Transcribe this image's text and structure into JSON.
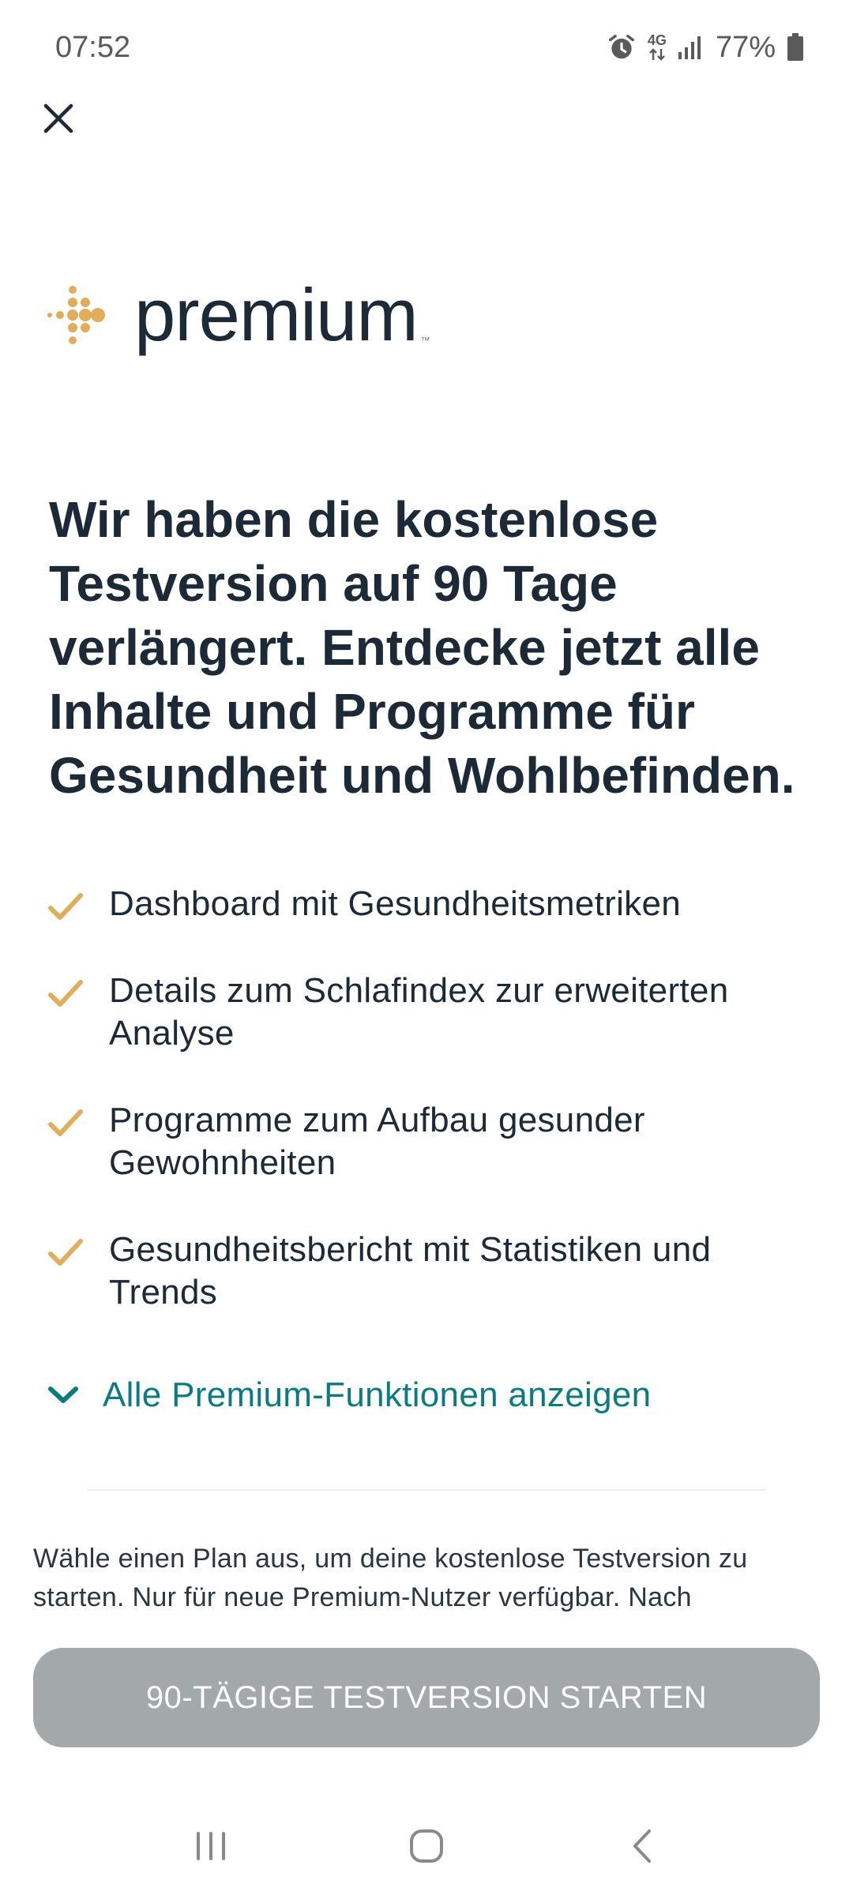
{
  "status_bar": {
    "time": "07:52",
    "network": "4G",
    "battery": "77%",
    "icons": [
      "alarm-icon",
      "network-4g-icon",
      "signal-icon",
      "battery-icon"
    ]
  },
  "close_icon": "close-icon",
  "logo": {
    "word": "premium",
    "tm": "™",
    "accent_color": "#e0ad5a"
  },
  "headline": "Wir haben die kostenlose Testversion auf 90 Tage verlängert. Entdecke jetzt alle Inhalte und Programme für Gesundheit und Wohlbefinden.",
  "features": [
    "Dashboard mit Gesundheitsmetriken",
    "Details zum Schlafindex zur erweiterten Analyse",
    "Programme zum Aufbau gesunder Gewohnheiten",
    "Gesundheitsbericht mit Statistiken und Trends"
  ],
  "show_all": "Alle Premium-Funktionen anzeigen",
  "disclaimer": "Wähle einen Plan aus, um deine kostenlose Testversion zu starten. Nur für neue Premium-Nutzer verfügbar. Nach",
  "cta_label": "90-TÄGIGE TESTVERSION STARTEN",
  "colors": {
    "text": "#1b2a36",
    "accent_gold": "#e0ad5a",
    "link_teal": "#0b7b80",
    "cta_disabled": "#a3a8ab"
  },
  "nav_bar": [
    "recent-apps-icon",
    "home-icon",
    "back-icon"
  ]
}
